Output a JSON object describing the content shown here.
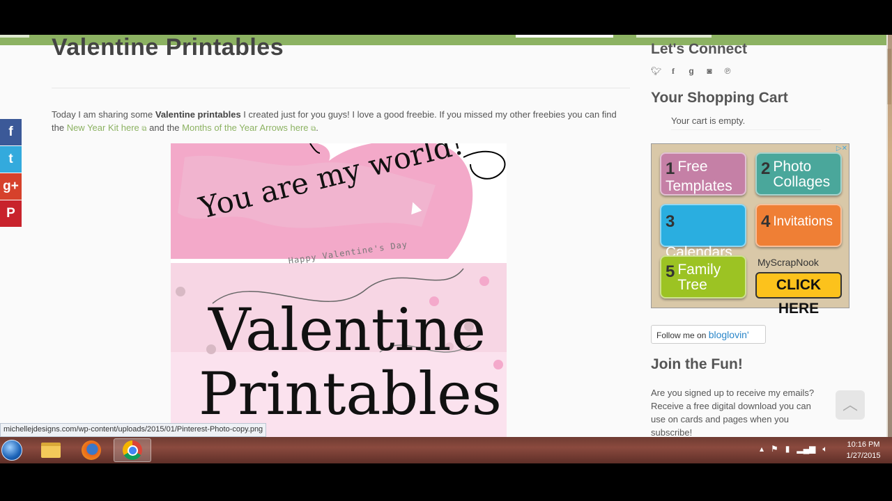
{
  "post": {
    "title": "Valentine Printables",
    "intro_1": "Today I am sharing some ",
    "intro_bold": "Valentine printables",
    "intro_2": " I created just for you guys!  I love a good freebie.  If you missed my other freebies you can find the ",
    "link_1": "New Year Kit here",
    "intro_3": " and the ",
    "link_2": "Months of the Year Arrows here",
    "intro_4": "."
  },
  "hero": {
    "heart_text": "You are my world!",
    "small_text": "Happy Valentine's Day",
    "big_line_1": "Valentine",
    "big_line_2": "Printables"
  },
  "share": {
    "facebook": "f",
    "twitter": "t",
    "googleplus": "g+",
    "pinterest": "P"
  },
  "sidebar": {
    "connect_heading": "Let's Connect",
    "cart_heading": "Your Shopping Cart",
    "cart_empty": "Your cart is empty.",
    "join_heading": "Join the Fun!",
    "join_text": "Are you signed up to receive my emails? Receive a free digital download you can use on cards and pages when you subscribe!",
    "bloglovin_follow": "Follow me on ",
    "bloglovin_brand": "bloglovin'"
  },
  "ad": {
    "items": [
      {
        "num": "1",
        "label": "Free Templates"
      },
      {
        "num": "2",
        "label": "Photo Collages"
      },
      {
        "num": "3",
        "label": "Calendars"
      },
      {
        "num": "4",
        "label": "Invitations"
      },
      {
        "num": "5",
        "label": "Family Tree"
      }
    ],
    "brand": "MyScrapNook",
    "cta": "CLICK HERE"
  },
  "status_url": "michellejdesigns.com/wp-content/uploads/2015/01/Pinterest-Photo-copy.png",
  "taskbar": {
    "time": "10:16 PM",
    "date": "1/27/2015"
  }
}
